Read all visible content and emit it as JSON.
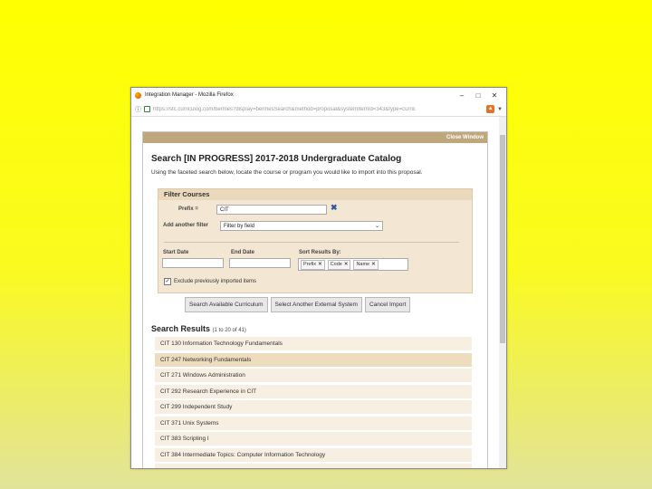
{
  "browser": {
    "window_title": "Integration Manager - Mozilla Firefox",
    "url": "https://stc.curriculog.com/bermes?display=bermesSearch&method=proposal&systemItemId=343&type=curric"
  },
  "modal": {
    "close_label": "Close Window",
    "title": "Search [IN PROGRESS] 2017-2018 Undergraduate Catalog",
    "instructions": "Using the faceted search below, locate the course or program you would like to import into this proposal."
  },
  "filter": {
    "heading": "Filter Courses",
    "prefix_label": "Prefix =",
    "prefix_value": "CIT",
    "add_filter_label": "Add another filter",
    "add_filter_value": "Filter by field",
    "start_date_label": "Start Date",
    "end_date_label": "End Date",
    "sort_label": "Sort Results By:",
    "sort_chips": [
      "Prefix",
      "Code",
      "Name"
    ],
    "exclude_label": "Exclude previously imported items",
    "exclude_checked": true
  },
  "actions": {
    "search_label": "Search Available Curriculum",
    "select_system_label": "Select Another External System",
    "cancel_label": "Cancel Import"
  },
  "results": {
    "title": "Search Results",
    "range": "(1 to 20 of 41)",
    "items": [
      "CIT 130 Information Technology Fundamentals",
      "CIT 247 Networking Fundamentals",
      "CIT 271 Windows Administration",
      "CIT 292 Research Experience in CIT",
      "CIT 299 Independent Study",
      "CIT 371 Unix Systems",
      "CIT 383 Scripting I",
      "CIT 384 Intermediate Topics: Computer Information Technology"
    ]
  }
}
